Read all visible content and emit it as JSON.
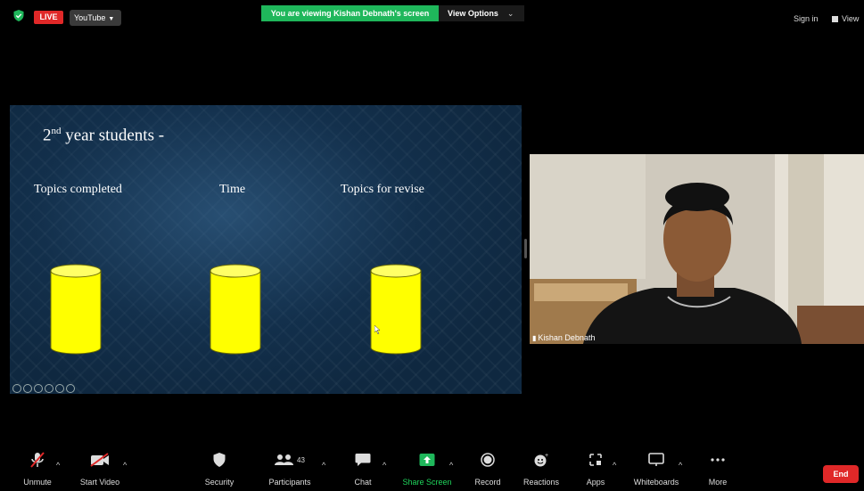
{
  "topbar": {
    "live_label": "LIVE",
    "youtube_label": "YouTube",
    "viewing_banner": "You are viewing Kishan Debnath's screen",
    "view_options_label": "View Options",
    "sign_in_label": "Sign in",
    "view_label": "View"
  },
  "slide": {
    "title_prefix": "2",
    "title_sup": "nd",
    "title_suffix": " year students -",
    "topics": [
      "Topics completed",
      "Time",
      "Topics for revise"
    ]
  },
  "video": {
    "participant_name": "Kishan Debnath"
  },
  "toolbar": {
    "unmute": "Unmute",
    "start_video": "Start Video",
    "security": "Security",
    "participants": "Participants",
    "participants_count": "43",
    "chat": "Chat",
    "share_screen": "Share Screen",
    "record": "Record",
    "reactions": "Reactions",
    "apps": "Apps",
    "whiteboards": "Whiteboards",
    "more": "More",
    "end": "End"
  },
  "colors": {
    "live_red": "#e02828",
    "share_green": "#1fb75b",
    "cylinder_yellow": "#ffff00"
  }
}
